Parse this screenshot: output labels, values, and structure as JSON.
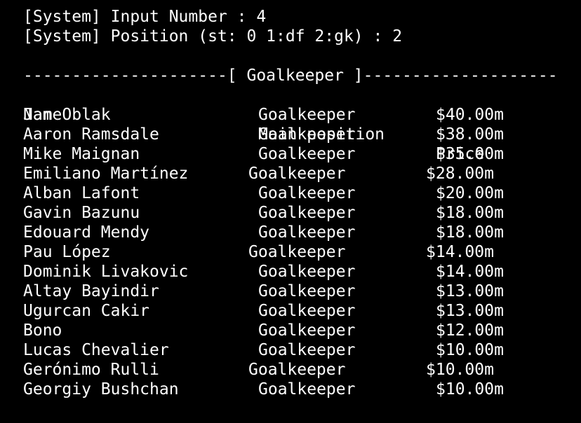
{
  "system": {
    "input_line": "[System] Input Number : 4",
    "position_line": "[System] Position (st: 0 1:df 2:gk) : 2"
  },
  "section": {
    "header_line": "---------------------[ Goalkeeper ]--------------------"
  },
  "table": {
    "columns": [
      "Name",
      "Main position",
      "Price"
    ],
    "rows": [
      {
        "name": "Jan Oblak",
        "position": "Goalkeeper",
        "price": "$40.00m"
      },
      {
        "name": "Aaron Ramsdale",
        "position": "Goalkeeper",
        "price": "$38.00m"
      },
      {
        "name": "Mike Maignan",
        "position": "Goalkeeper",
        "price": "$35.00m"
      },
      {
        "name": "Emiliano Martínez",
        "position": "Goalkeeper",
        "price": "$28.00m"
      },
      {
        "name": "Alban Lafont",
        "position": "Goalkeeper",
        "price": "$20.00m"
      },
      {
        "name": "Gavin Bazunu",
        "position": "Goalkeeper",
        "price": "$18.00m"
      },
      {
        "name": "Edouard Mendy",
        "position": "Goalkeeper",
        "price": "$18.00m"
      },
      {
        "name": "Pau López",
        "position": "Goalkeeper",
        "price": "$14.00m"
      },
      {
        "name": "Dominik Livakovic",
        "position": "Goalkeeper",
        "price": "$14.00m"
      },
      {
        "name": "Altay Bayindir",
        "position": "Goalkeeper",
        "price": "$13.00m"
      },
      {
        "name": "Ugurcan Cakir",
        "position": "Goalkeeper",
        "price": "$13.00m"
      },
      {
        "name": "Bono",
        "position": "Goalkeeper",
        "price": "$12.00m"
      },
      {
        "name": "Lucas Chevalier",
        "position": "Goalkeeper",
        "price": "$10.00m"
      },
      {
        "name": "Gerónimo Rulli",
        "position": "Goalkeeper",
        "price": "$10.00m"
      },
      {
        "name": "Georgiy Bushchan",
        "position": "Goalkeeper",
        "price": "$10.00m"
      }
    ]
  }
}
